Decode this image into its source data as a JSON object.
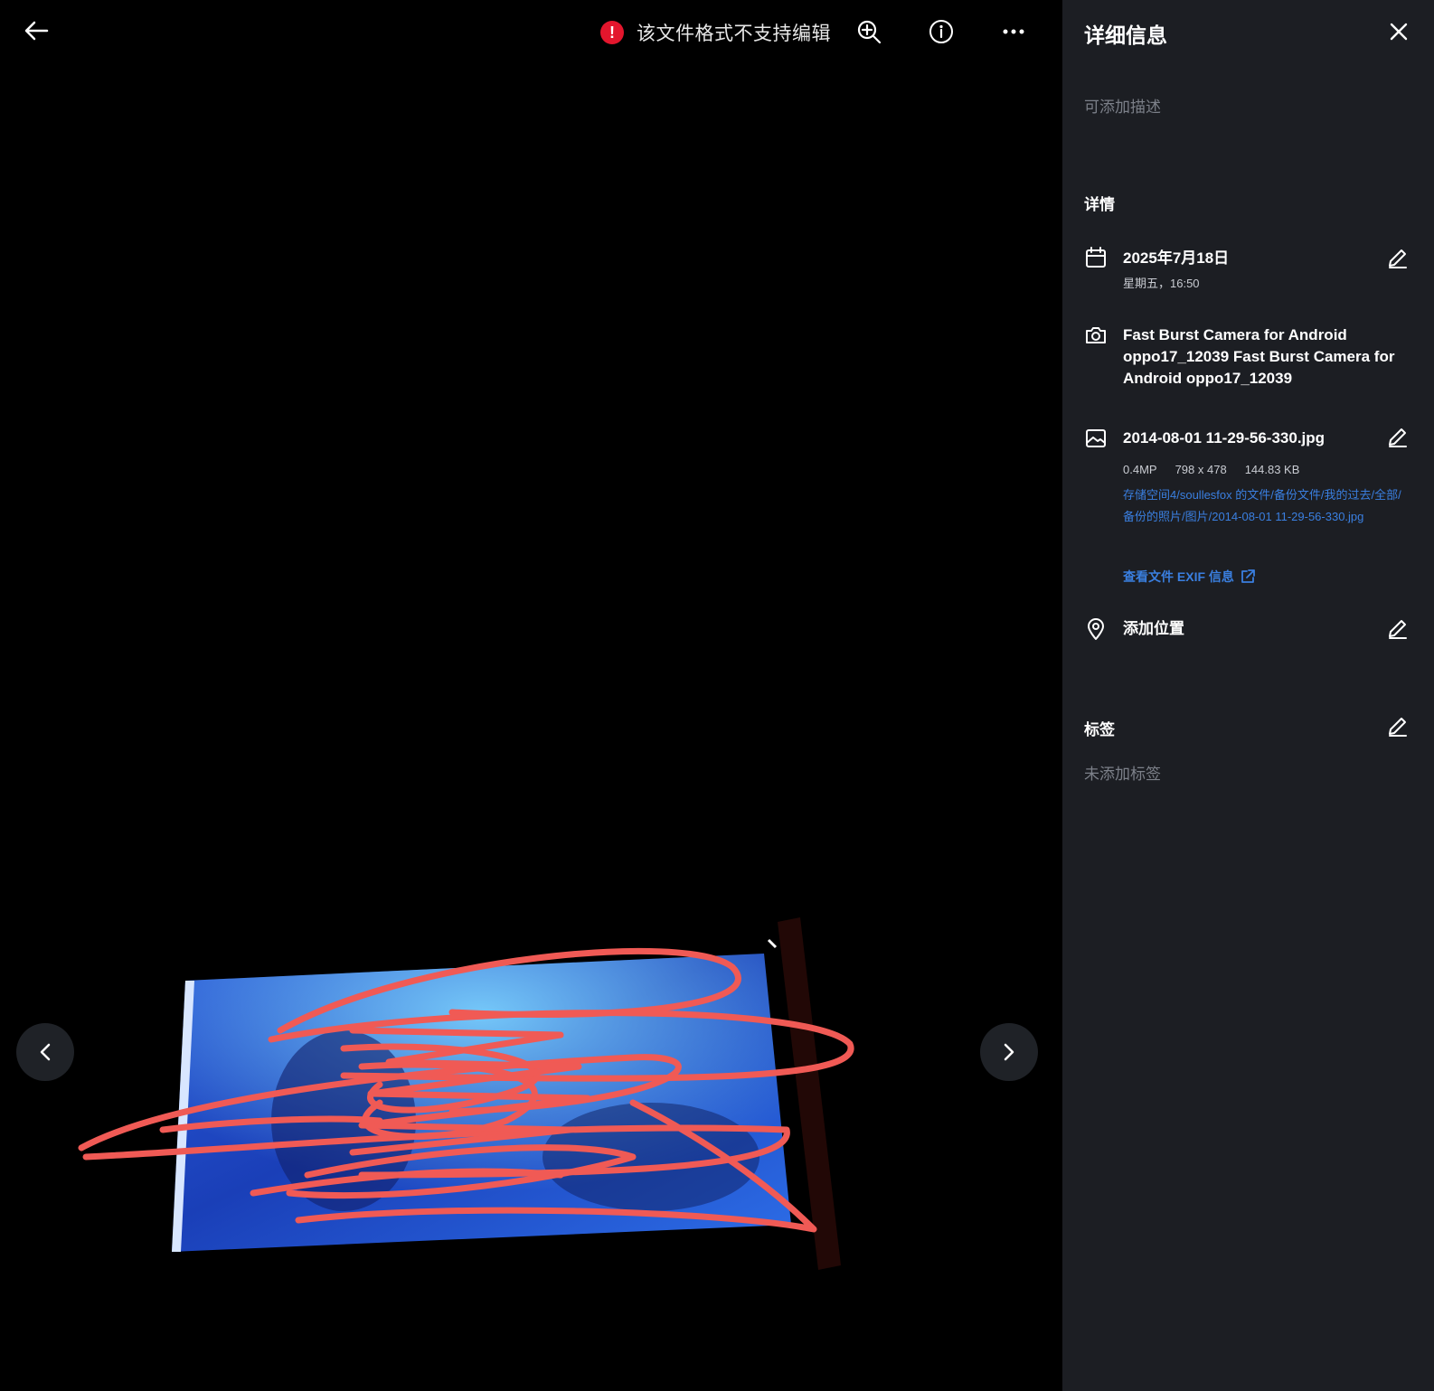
{
  "toast": {
    "message": "该文件格式不支持编辑"
  },
  "panel": {
    "title": "详细信息",
    "description_placeholder": "可添加描述",
    "details_heading": "详情",
    "date": {
      "main": "2025年7月18日",
      "sub": "星期五，16:50"
    },
    "camera": {
      "line1": "Fast Burst Camera for Android",
      "line2": "oppo17_12039 Fast Burst Camera for",
      "line3": "Android oppo17_12039"
    },
    "file": {
      "name": "2014-08-01 11-29-56-330.jpg",
      "megapixels": "0.4MP",
      "resolution": "798 x 478",
      "size": "144.83 KB",
      "path": "存储空间4/soullesfox 的文件/备份文件/我的过去/全部/备份的照片/图片/2014-08-01 11-29-56-330.jpg",
      "exif_link": "查看文件 EXIF 信息"
    },
    "location": {
      "label": "添加位置"
    },
    "tags_heading": "标签",
    "tags_placeholder": "未添加标签"
  },
  "colors": {
    "error": "#e3162d",
    "link": "#3a7fe0",
    "panel_bg": "#1c1e23",
    "scribble": "#f05a55"
  },
  "icons": [
    "back-arrow-icon",
    "error-icon",
    "zoom-in-icon",
    "info-icon",
    "more-icon",
    "close-icon",
    "calendar-icon",
    "camera-icon",
    "image-icon",
    "location-pin-icon",
    "edit-pencil-icon",
    "external-link-icon",
    "chevron-left-icon",
    "chevron-right-icon"
  ]
}
